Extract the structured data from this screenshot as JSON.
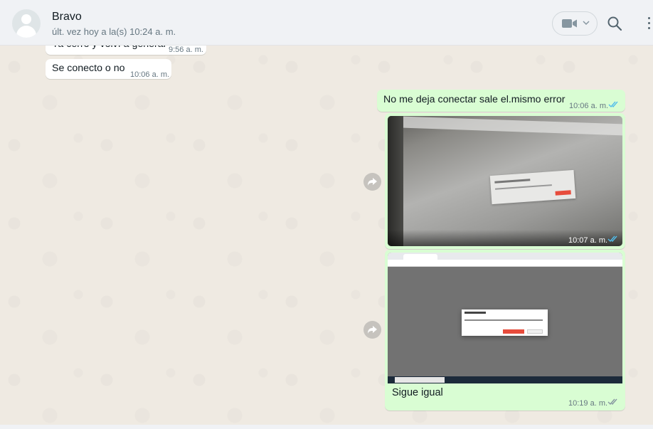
{
  "header": {
    "contact_name": "Bravo",
    "status": "últ. vez hoy a la(s) 10:24 a. m.",
    "icons": [
      "avatar-placeholder",
      "video-call-icon",
      "chevron-down-icon",
      "search-icon",
      "menu-icon"
    ]
  },
  "messages": [
    {
      "direction": "in",
      "text": "Ya cerró y volví a generar",
      "time": "9:56 a. m."
    },
    {
      "direction": "in",
      "text": "Se conecto o no",
      "time": "10:06 a. m."
    },
    {
      "direction": "out",
      "text": "No me deja conectar sale el.mismo error",
      "time": "10:06 a. m.",
      "status": "read"
    },
    {
      "direction": "out",
      "type": "image",
      "description_icon": "screen-photo",
      "time": "10:07 a. m.",
      "status": "read"
    },
    {
      "direction": "out",
      "type": "image",
      "caption": "Sigue igual",
      "time": "10:19 a. m.",
      "status": "delivered"
    }
  ],
  "colors": {
    "incoming_bubble": "#ffffff",
    "outgoing_bubble": "#d9fdd3",
    "read_ticks": "#53bdeb",
    "delivered_ticks": "#8696a0",
    "chat_background": "#efeae2",
    "header_background": "#f0f2f5"
  }
}
